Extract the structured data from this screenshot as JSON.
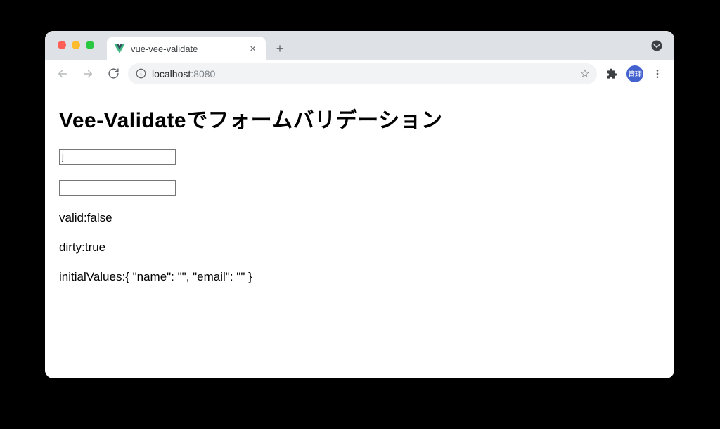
{
  "browser": {
    "tab": {
      "title": "vue-vee-validate",
      "favicon": "vue-logo"
    },
    "toolbar": {
      "back_disabled": true,
      "forward_disabled": true,
      "url_host": "localhost",
      "url_port": ":8080",
      "avatar_label": "管理"
    }
  },
  "page": {
    "heading": "Vee-Validateでフォームバリデーション",
    "inputs": {
      "name_value": "j",
      "email_value": ""
    },
    "status": {
      "valid_label": "valid:",
      "valid_value": "false",
      "dirty_label": "dirty:",
      "dirty_value": "true",
      "initial_label": "initialValues:",
      "initial_value": "{ \"name\": \"\", \"email\": \"\" }"
    }
  }
}
